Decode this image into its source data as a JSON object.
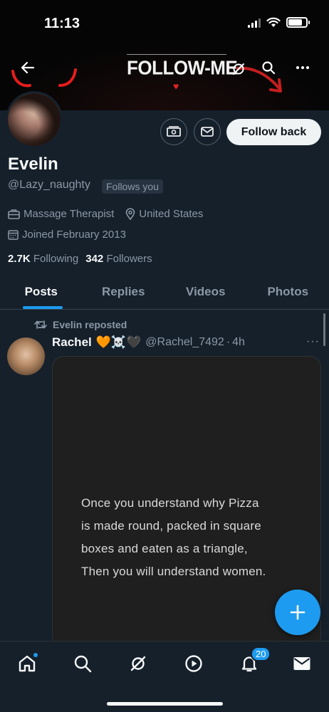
{
  "status_bar": {
    "time": "11:13"
  },
  "banner": {
    "text": "FOLLOW-ME",
    "heart": "♥"
  },
  "profile": {
    "display_name": "Evelin",
    "handle": "@Lazy_naughty",
    "follows_you": "Follows you",
    "profession": "Massage Therapist",
    "location": "United States",
    "joined": "Joined February 2013",
    "following_count": "2.7K",
    "following_label": "Following",
    "followers_count": "342",
    "followers_label": "Followers",
    "follow_back_label": "Follow back"
  },
  "tabs": [
    {
      "label": "Posts",
      "active": true
    },
    {
      "label": "Replies",
      "active": false
    },
    {
      "label": "Videos",
      "active": false
    },
    {
      "label": "Photos",
      "active": false
    }
  ],
  "post": {
    "repost_label": "Evelin reposted",
    "author_name": "Rachel",
    "author_emojis": "🧡☠️🖤",
    "author_handle": "@Rachel_7492",
    "separator": "·",
    "time": "4h",
    "more": "···",
    "quote_lines": [
      "Once you understand why Pizza",
      "is made round, packed in square",
      "boxes and eaten as a triangle,",
      "Then you will understand women."
    ]
  },
  "bottom_nav": {
    "notifications_badge": "20"
  },
  "colors": {
    "background": "#15202b",
    "accent": "#1d9bf0",
    "secondary_text": "#8b98a5",
    "primary_text": "#f7f9f9",
    "banner_heart": "#e02424"
  }
}
